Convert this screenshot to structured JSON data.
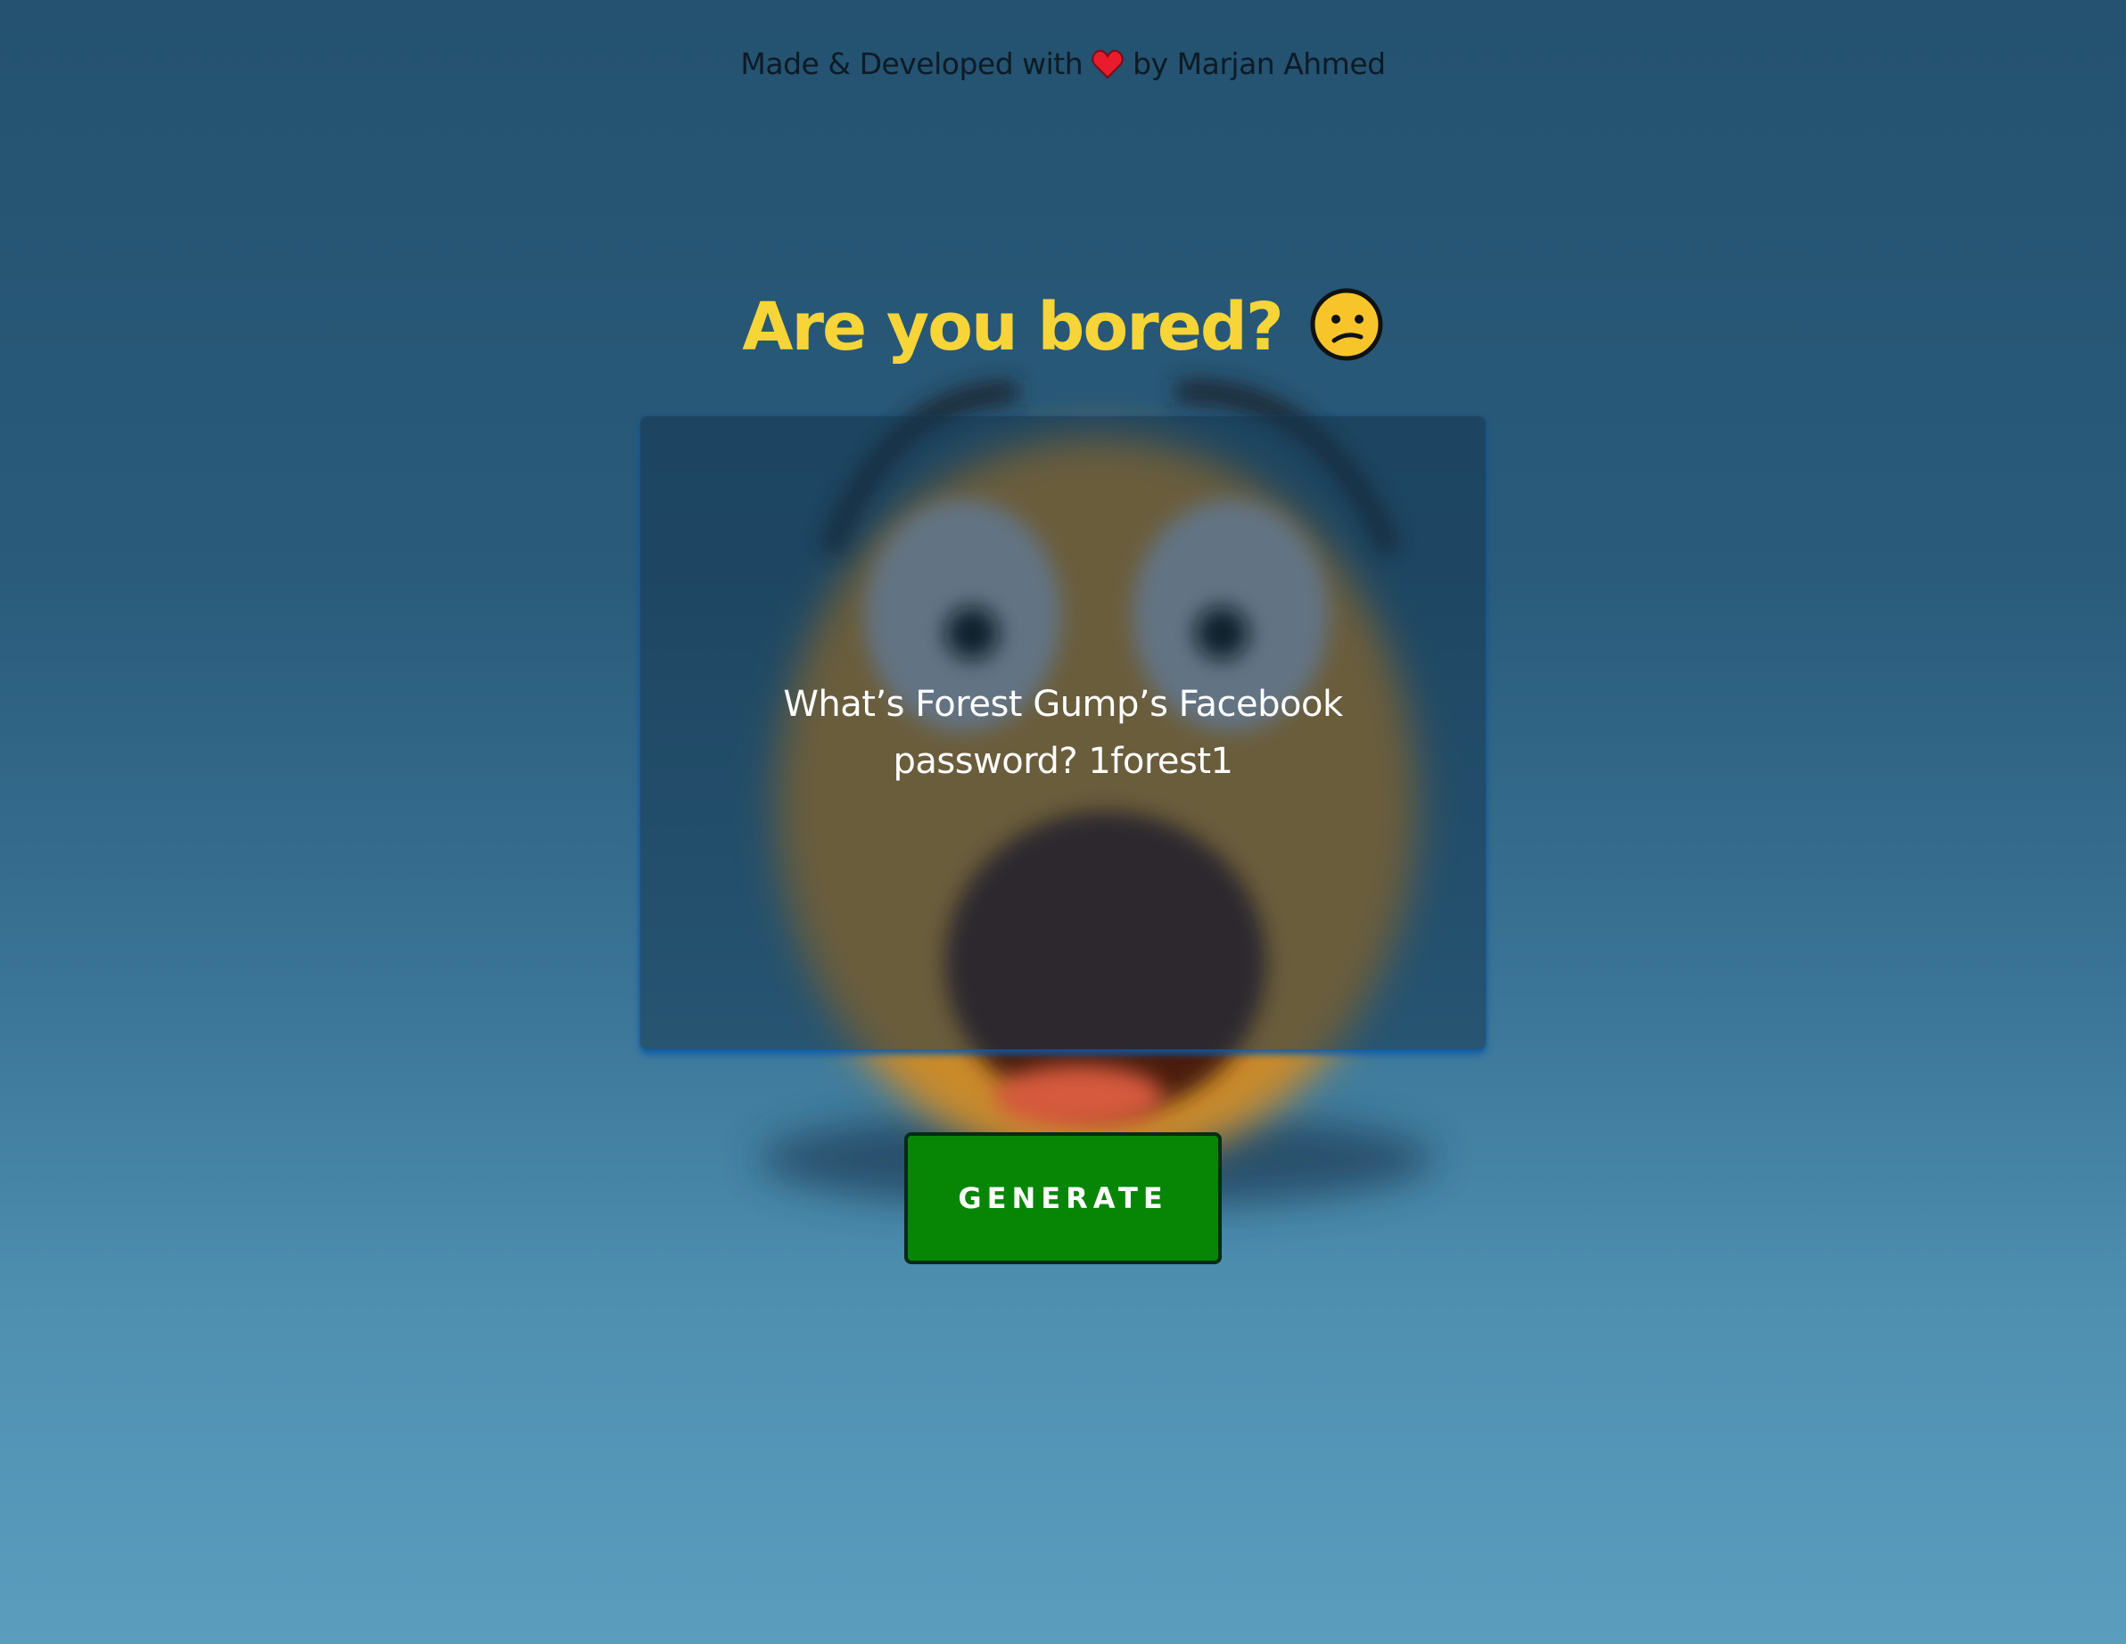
{
  "footer_credit": {
    "prefix": "Made & Developed with",
    "icon": "heart-icon",
    "suffix": "by Marjan Ahmed",
    "heart_color": "#e81c2c"
  },
  "header": {
    "title": "Are you bored?",
    "emoji_icon": "confused-face-icon"
  },
  "card": {
    "joke_text": "What’s Forest Gump’s Facebook password? 1forest1"
  },
  "actions": {
    "generate_label": "GENERATE"
  },
  "colors": {
    "title": "#f7d538",
    "button": "#078606",
    "background_top": "#245270",
    "background_bottom": "#5a9dbd"
  }
}
